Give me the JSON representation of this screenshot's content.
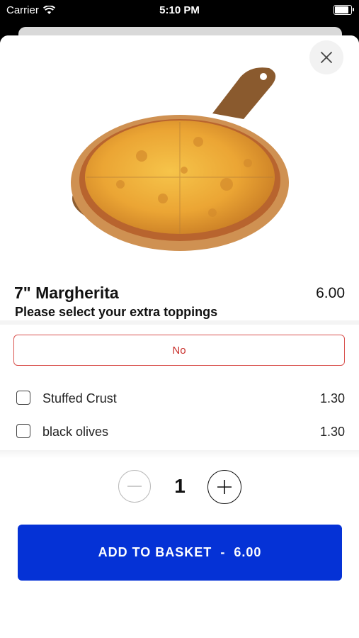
{
  "status_bar": {
    "carrier": "Carrier",
    "time": "5:10 PM",
    "battery_level": 1.0
  },
  "product": {
    "name": "7\" Margherita",
    "price": "6.00",
    "image": "pizza-image"
  },
  "options": {
    "title": "Please select your extra toppings",
    "selected_option": "No",
    "toppings": [
      {
        "label": "Stuffed Crust",
        "price": "1.30",
        "checked": false
      },
      {
        "label": "black olives",
        "price": "1.30",
        "checked": false
      }
    ]
  },
  "quantity": {
    "value": "1"
  },
  "cta": {
    "label": "ADD TO BASKET",
    "separator": "-",
    "price": "6.00",
    "color": "#0532d6"
  }
}
